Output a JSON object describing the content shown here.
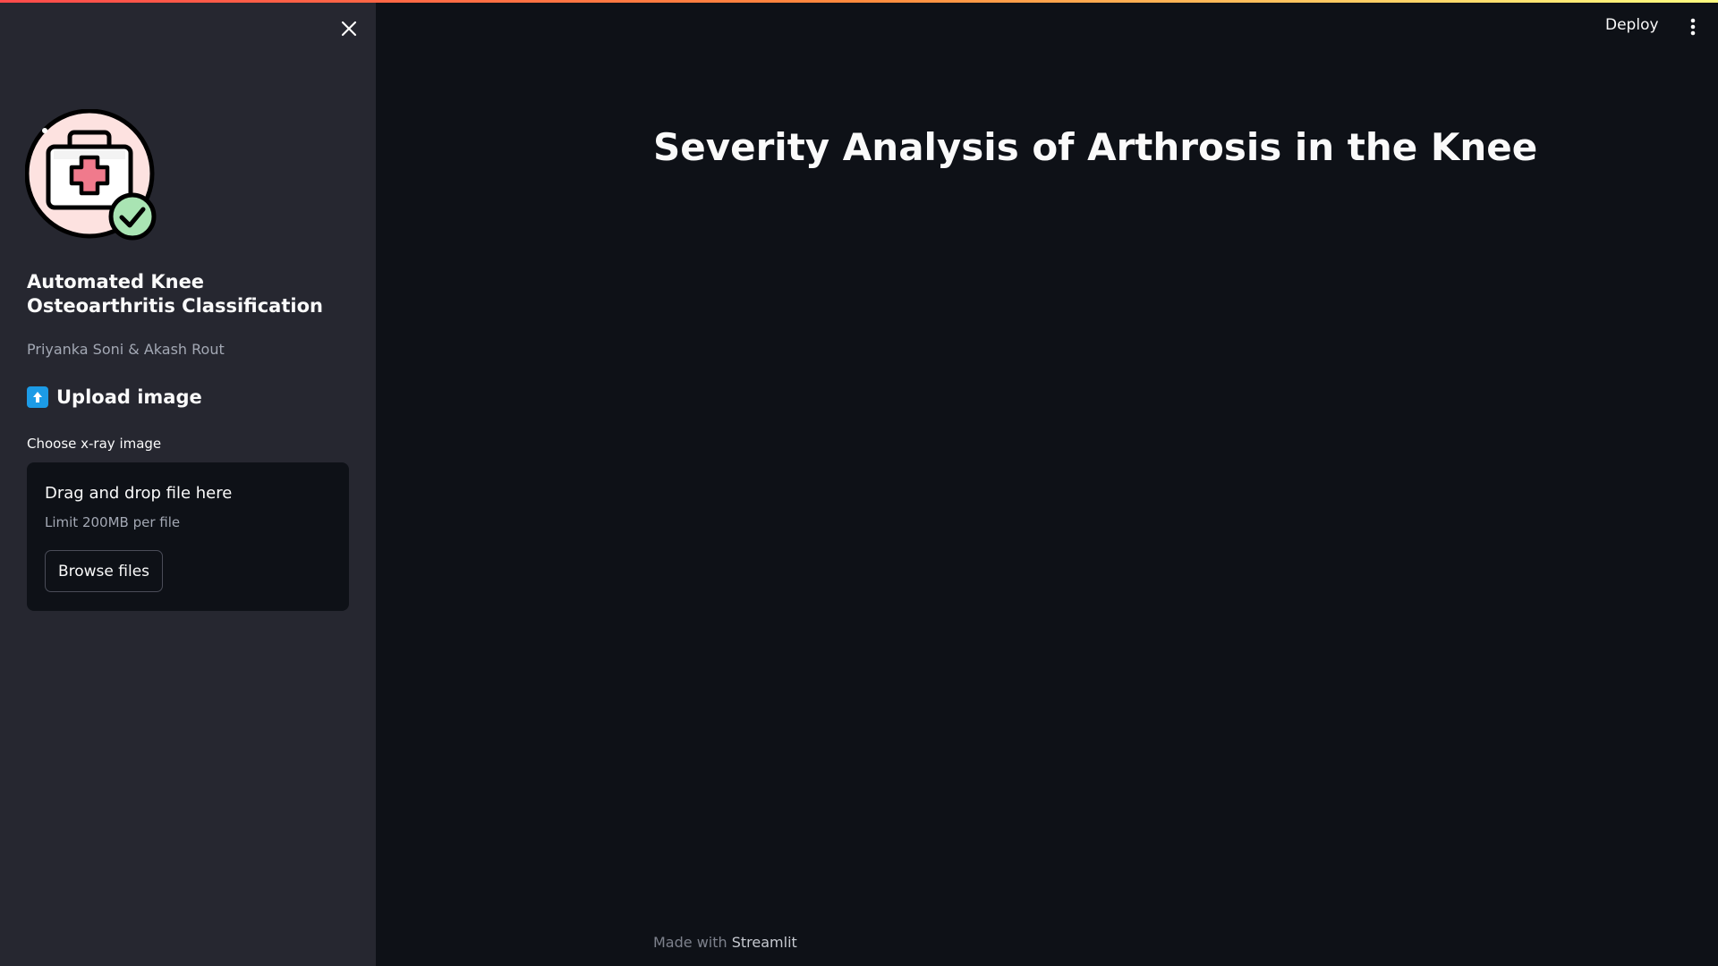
{
  "sidebar": {
    "close_icon": "close-icon",
    "logo_icon": "medical-kit-check-icon",
    "app_title": "Automated Knee Osteoarthritis Classification",
    "authors": "Priyanka Soni & Akash Rout",
    "upload": {
      "heading_icon": "arrow-up-icon",
      "heading": "Upload image",
      "label": "Choose x-ray image",
      "dropzone_title": "Drag and drop file here",
      "dropzone_limit": "Limit 200MB per file",
      "browse_label": "Browse files"
    }
  },
  "header": {
    "deploy_label": "Deploy",
    "menu_icon": "more-vertical-icon"
  },
  "main": {
    "title": "Severity Analysis of Arthrosis in the Knee"
  },
  "footer": {
    "prefix": "Made with ",
    "brand": "Streamlit"
  },
  "colors": {
    "sidebar_bg": "#262730",
    "main_bg": "#0e1117",
    "accent_gradient_start": "#ff4b4b",
    "accent_gradient_end": "#fffd80",
    "logo_circle": "#fde2e0",
    "check_badge": "#a9e4b3",
    "upload_icon": "#1c9be6"
  }
}
